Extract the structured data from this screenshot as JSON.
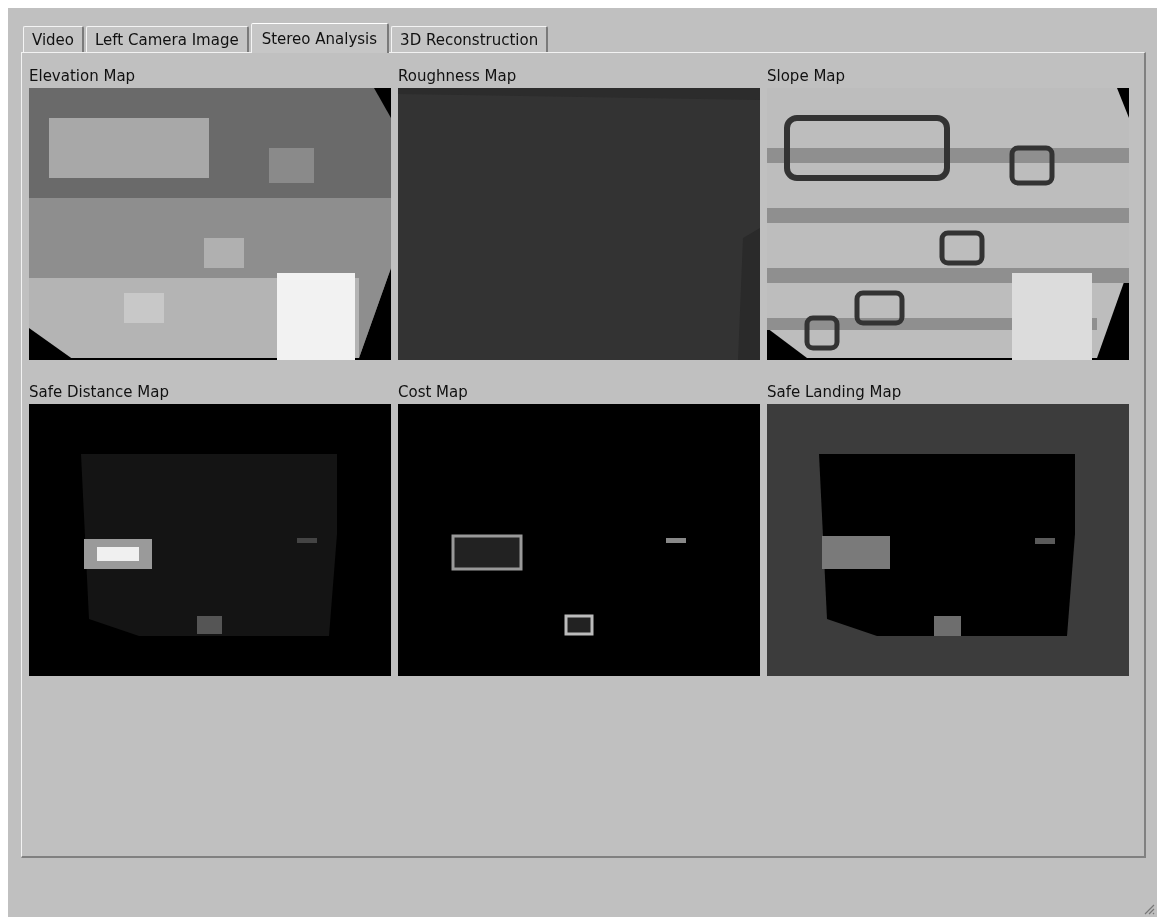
{
  "tabs": [
    {
      "label": "Video",
      "selected": false
    },
    {
      "label": "Left Camera Image",
      "selected": false
    },
    {
      "label": "Stereo Analysis",
      "selected": true
    },
    {
      "label": "3D Reconstruction",
      "selected": false
    }
  ],
  "maps": [
    {
      "title": "Elevation Map",
      "kind": "picture"
    },
    {
      "title": "Roughness Map",
      "kind": "picture"
    },
    {
      "title": "Slope Map",
      "kind": "picture"
    },
    {
      "title": "Safe Distance Map",
      "kind": "picture"
    },
    {
      "title": "Cost Map",
      "kind": "picture"
    },
    {
      "title": "Safe Landing Map",
      "kind": "picture"
    }
  ]
}
